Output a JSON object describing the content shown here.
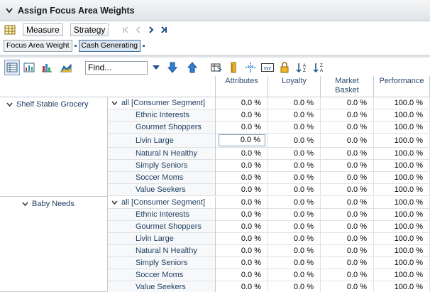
{
  "window": {
    "title": "Assign Focus Area Weights"
  },
  "tabs": {
    "measure": "Measure",
    "strategy": "Strategy"
  },
  "breadcrumb": {
    "item1": "Focus Area Weight",
    "item2": "Cash Generating"
  },
  "toolbar": {
    "find_value": "Find..."
  },
  "columns": [
    "Attributes",
    "Loyalty",
    "Market\nBasket",
    "Performance"
  ],
  "groups": [
    {
      "label": "Shelf Stable Grocery",
      "rows": [
        {
          "segment": "all [Consumer Segment]",
          "values": [
            "0.0 %",
            "0.0 %",
            "0.0 %",
            "100.0 %"
          ]
        },
        {
          "segment": "Ethnic Interests",
          "values": [
            "0.0 %",
            "0.0 %",
            "0.0 %",
            "100.0 %"
          ]
        },
        {
          "segment": "Gourmet Shoppers",
          "values": [
            "0.0 %",
            "0.0 %",
            "0.0 %",
            "100.0 %"
          ]
        },
        {
          "segment": "Livin Large",
          "values": [
            "0.0 %",
            "0.0 %",
            "0.0 %",
            "100.0 %"
          ]
        },
        {
          "segment": "Natural N Healthy",
          "values": [
            "0.0 %",
            "0.0 %",
            "0.0 %",
            "100.0 %"
          ]
        },
        {
          "segment": "Simply Seniors",
          "values": [
            "0.0 %",
            "0.0 %",
            "0.0 %",
            "100.0 %"
          ]
        },
        {
          "segment": "Soccer Moms",
          "values": [
            "0.0 %",
            "0.0 %",
            "0.0 %",
            "100.0 %"
          ]
        },
        {
          "segment": "Value Seekers",
          "values": [
            "0.0 %",
            "0.0 %",
            "0.0 %",
            "100.0 %"
          ]
        }
      ]
    },
    {
      "label": "Baby Needs",
      "rows": [
        {
          "segment": "all [Consumer Segment]",
          "values": [
            "0.0 %",
            "0.0 %",
            "0.0 %",
            "100.0 %"
          ]
        },
        {
          "segment": "Ethnic Interests",
          "values": [
            "0.0 %",
            "0.0 %",
            "0.0 %",
            "100.0 %"
          ]
        },
        {
          "segment": "Gourmet Shoppers",
          "values": [
            "0.0 %",
            "0.0 %",
            "0.0 %",
            "100.0 %"
          ]
        },
        {
          "segment": "Livin Large",
          "values": [
            "0.0 %",
            "0.0 %",
            "0.0 %",
            "100.0 %"
          ]
        },
        {
          "segment": "Natural N Healthy",
          "values": [
            "0.0 %",
            "0.0 %",
            "0.0 %",
            "100.0 %"
          ]
        },
        {
          "segment": "Simply Seniors",
          "values": [
            "0.0 %",
            "0.0 %",
            "0.0 %",
            "100.0 %"
          ]
        },
        {
          "segment": "Soccer Moms",
          "values": [
            "0.0 %",
            "0.0 %",
            "0.0 %",
            "100.0 %"
          ]
        },
        {
          "segment": "Value Seekers",
          "values": [
            "0.0 %",
            "0.0 %",
            "0.0 %",
            "100.0 %"
          ]
        }
      ]
    }
  ],
  "colors": {
    "header_text": "#2a4a6a",
    "dim_text": "#1f3f63",
    "accent": "#1f6fd1"
  }
}
